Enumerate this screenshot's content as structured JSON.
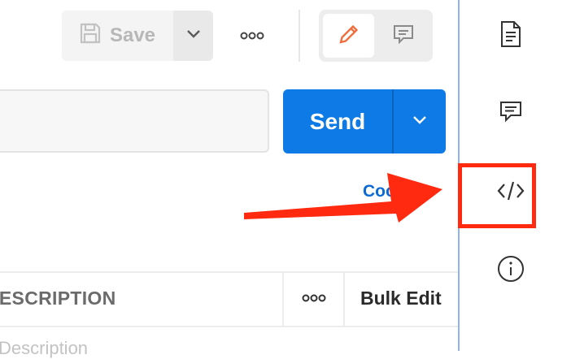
{
  "toolbar": {
    "save_label": "Save",
    "save_icon": "floppy-disk-icon",
    "dropdown_icon": "chevron-down-icon",
    "more_icon": "more-horizontal-icon",
    "edit_icon": "pencil-icon",
    "comment_icon": "comment-icon"
  },
  "request": {
    "url_value": "",
    "send_label": "Send",
    "send_dropdown_icon": "chevron-down-icon",
    "cookies_label": "Cookies"
  },
  "params_table": {
    "header_description": "DESCRIPTION",
    "header_more_icon": "more-horizontal-icon",
    "bulk_edit_label": "Bulk Edit",
    "description_placeholder": "Description"
  },
  "sidebar": {
    "items": [
      {
        "icon": "document-icon"
      },
      {
        "icon": "comment-icon"
      },
      {
        "icon": "code-icon",
        "highlighted": true
      },
      {
        "icon": "info-icon"
      }
    ]
  },
  "annotation": {
    "arrow_color": "#ff2a10",
    "highlight_color": "#ff2a10"
  },
  "colors": {
    "accent": "#0e7ae6",
    "edit_icon": "#f26b3a",
    "link": "#0b6ad3"
  }
}
